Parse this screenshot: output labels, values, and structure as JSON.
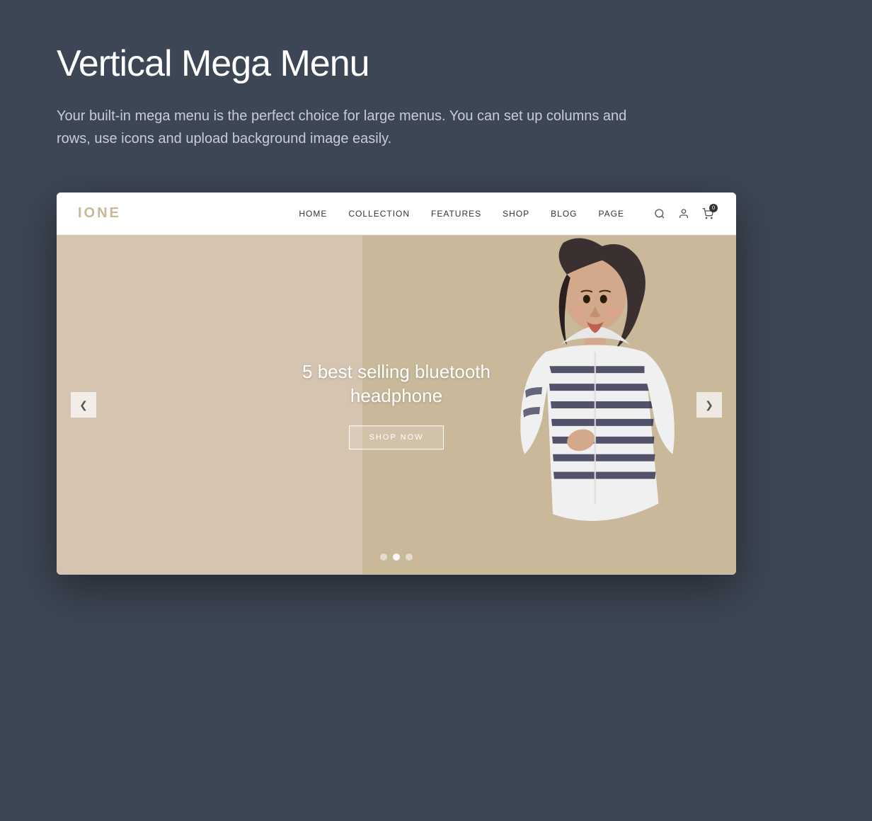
{
  "page": {
    "title": "Vertical Mega Menu",
    "description": "Your built-in mega menu is the perfect choice for large menus. You can set up columns and rows, use icons and upload background image easily.",
    "bg_color": "#3d4654"
  },
  "store": {
    "logo": "IONE",
    "nav_items": [
      {
        "label": "HOME"
      },
      {
        "label": "COLLECTION"
      },
      {
        "label": "FEATURES"
      },
      {
        "label": "SHOP"
      },
      {
        "label": "BLOG"
      },
      {
        "label": "PAGE"
      }
    ],
    "cart_count": "0",
    "hero": {
      "title_line1": "5 best selling bluetooth",
      "title_line2": "headphone",
      "cta_label": "SHOP NOW",
      "dots": [
        {
          "active": false
        },
        {
          "active": true
        },
        {
          "active": false
        }
      ]
    }
  },
  "icons": {
    "search": "🔍",
    "account": "👤",
    "cart": "🛍",
    "arrow_left": "❮",
    "arrow_right": "❯"
  }
}
